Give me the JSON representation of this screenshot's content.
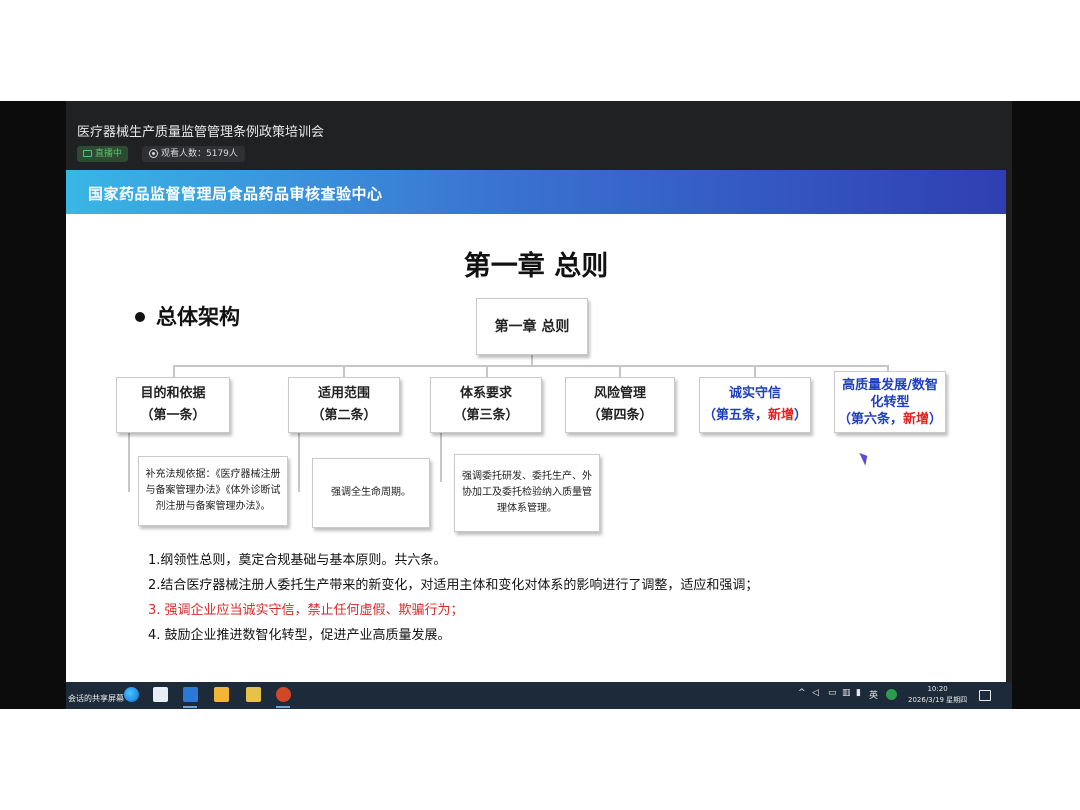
{
  "meeting": {
    "title": "医疗器械生产质量监管管理条例政策培训会",
    "live_label": "直播中",
    "viewers_label": "观看人数：5179人"
  },
  "slide": {
    "banner": "国家药品监督管理局食品药品审核查验中心",
    "chapter_title": "第一章 总则",
    "section_label": "总体架构",
    "root_box": "第一章 总则",
    "branches": [
      {
        "name": "目的和依据",
        "article": "（第一条）"
      },
      {
        "name": "适用范围",
        "article": "（第二条）"
      },
      {
        "name": "体系要求",
        "article": "（第三条）"
      },
      {
        "name": "风险管理",
        "article": "（第四条）"
      },
      {
        "name": "诚实守信",
        "article": "（第五条，",
        "new": "新增",
        "close": "）"
      },
      {
        "name_line1": "高质量发展/数智",
        "name_line2": "化转型",
        "article": "（第六条，",
        "new": "新增",
        "close": "）"
      }
    ],
    "notes": [
      "补充法规依据：《医疗器械注册与备案管理办法》《体外诊断试剂注册与备案管理办法》。",
      "强调全生命周期。",
      "强调委托研发、委托生产、外协加工及委托检验纳入质量管理体系管理。"
    ],
    "points": [
      "1.纲领性总则，奠定合规基础与基本原则。共六条。",
      "2.结合医疗器械注册人委托生产带来的新变化，对适用主体和变化对体系的影响进行了调整，适应和强调；",
      "3. 强调企业应当诚实守信，禁止任何虚假、欺骗行为；",
      "4. 鼓励企业推进数智化转型，促进产业高质量发展。"
    ]
  },
  "taskbar": {
    "share_label": "会话的共享屏幕",
    "ime_label": "英",
    "time": "10:20",
    "date": "2026/3/19 星期四"
  },
  "colors": {
    "banner_start": "#39b6e6",
    "banner_end": "#2f3fb2",
    "highlight_blue": "#1f3fbf",
    "highlight_red": "#e02222",
    "live_green": "#58c46a"
  }
}
